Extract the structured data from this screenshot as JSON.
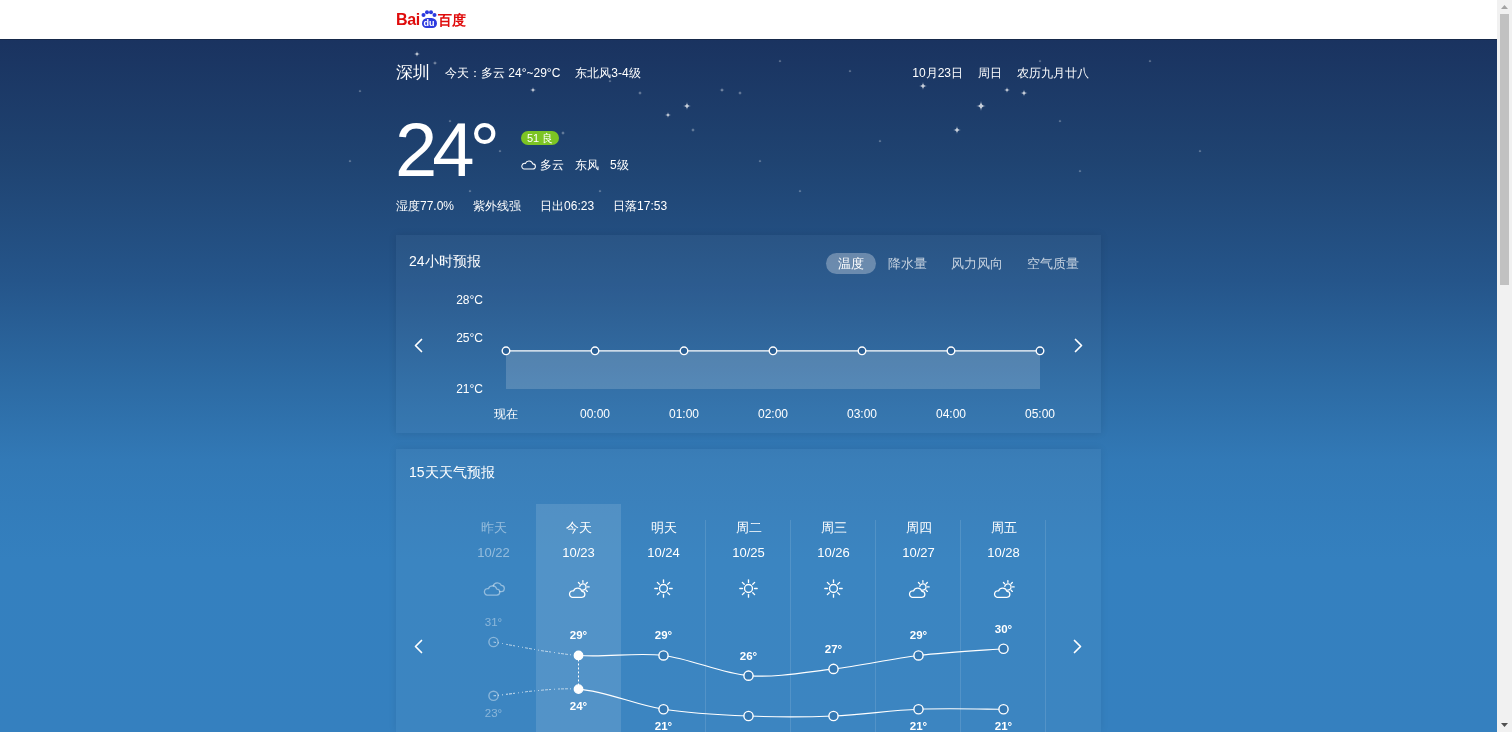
{
  "logo": {
    "latin": "Bai",
    "mark": "du",
    "chinese": "百度"
  },
  "header": {
    "city": "深圳",
    "forecast": "今天：多云 24°~29°C",
    "wind": "东北风3-4级",
    "date": "10月23日",
    "weekday": "周日",
    "lunar": "农历九月廿八"
  },
  "current": {
    "temperature": "24°",
    "aqi": "51 良",
    "condition": "多云",
    "wind_direction": "东风",
    "wind_level": "5级",
    "details": [
      "湿度77.0%",
      "紫外线强",
      "日出06:23",
      "日落17:53"
    ]
  },
  "hourly": {
    "title": "24小时预报",
    "tabs": [
      {
        "label": "温度",
        "selected": true
      },
      {
        "label": "降水量",
        "selected": false
      },
      {
        "label": "风力风向",
        "selected": false
      },
      {
        "label": "空气质量",
        "selected": false
      }
    ],
    "chart_data": {
      "type": "area",
      "categories": [
        "现在",
        "00:00",
        "01:00",
        "02:00",
        "03:00",
        "04:00",
        "05:00"
      ],
      "ylim": [
        21,
        28
      ],
      "yticks": [
        {
          "value": 28,
          "label": "28°C"
        },
        {
          "value": 25,
          "label": "25°C"
        },
        {
          "value": 21,
          "label": "21°C"
        }
      ],
      "series": [
        {
          "values": [
            24,
            24,
            24,
            24,
            24,
            24,
            24
          ],
          "marker": "circle"
        }
      ]
    }
  },
  "daily": {
    "title": "15天天气预报",
    "days": [
      {
        "weekday": "昨天",
        "kind": "cloudy",
        "past": true,
        "selected": false
      },
      {
        "weekday": "今天",
        "kind": "partly_cloudy",
        "past": false,
        "selected": true
      },
      {
        "weekday": "明天",
        "kind": "sunny",
        "past": false,
        "selected": false
      },
      {
        "weekday": "周二",
        "kind": "sunny",
        "past": false,
        "selected": false
      },
      {
        "weekday": "周三",
        "kind": "sunny",
        "past": false,
        "selected": false
      },
      {
        "weekday": "周四",
        "kind": "partly_cloudy",
        "past": false,
        "selected": false
      },
      {
        "weekday": "周五",
        "kind": "partly_cloudy",
        "past": false,
        "selected": false
      }
    ],
    "chart_data": {
      "type": "line",
      "categories": [
        "10/22",
        "10/23",
        "10/24",
        "10/25",
        "10/26",
        "10/27",
        "10/28"
      ],
      "series": [
        {
          "values": [
            31,
            29,
            29,
            26,
            27,
            29,
            30
          ],
          "marker": "circle",
          "value_labels": [
            "31°",
            "29°",
            "29°",
            "26°",
            "27°",
            "29°",
            "30°"
          ]
        },
        {
          "values": [
            23,
            24,
            21,
            20,
            20,
            21,
            21
          ],
          "marker": "circle",
          "value_labels": [
            "23°",
            "24°",
            "21°",
            null,
            null,
            "21°",
            "21°"
          ]
        }
      ]
    }
  }
}
